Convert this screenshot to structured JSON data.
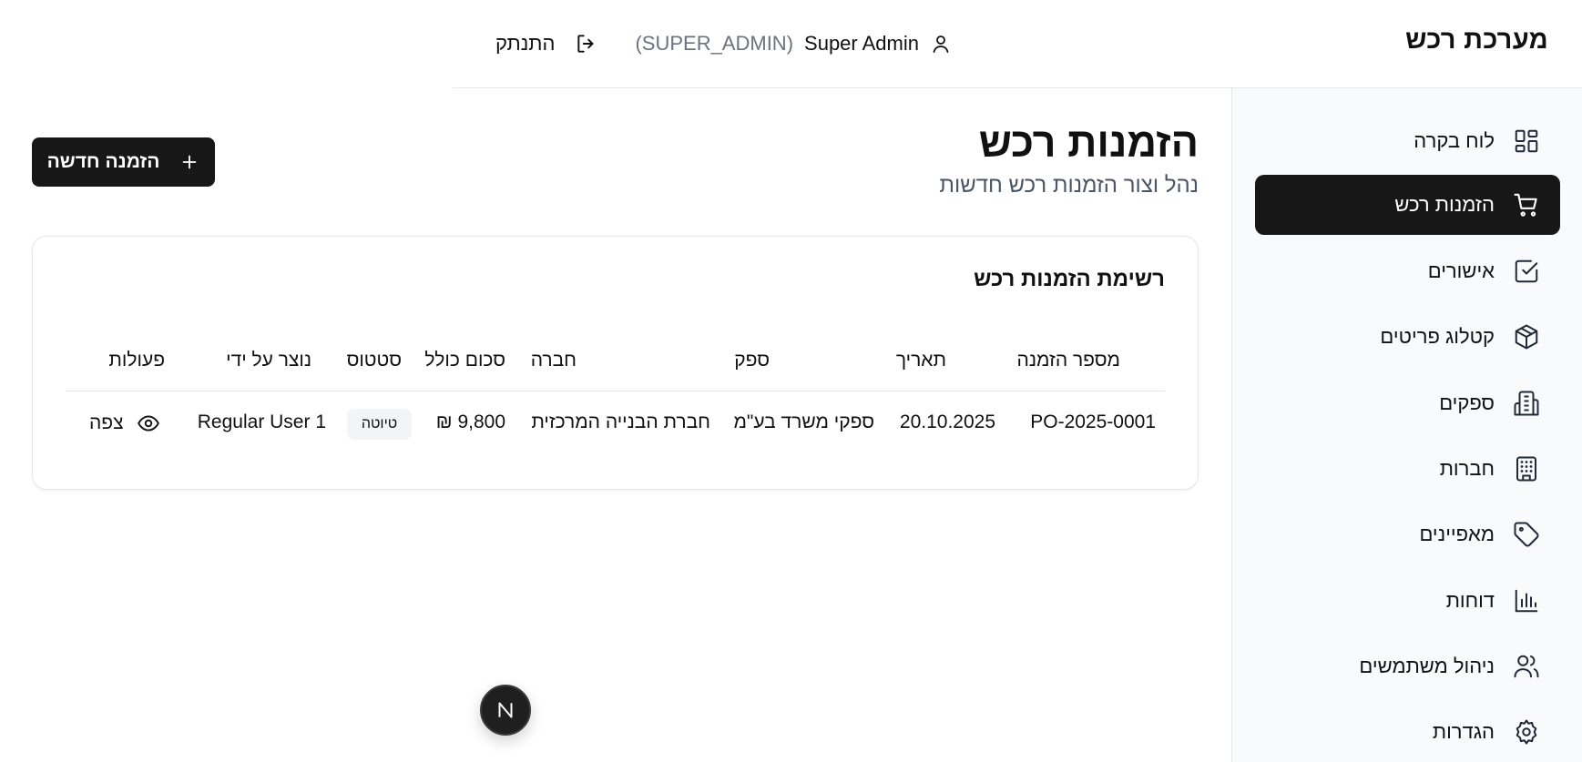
{
  "header": {
    "brand": "מערכת רכש",
    "username": "Super Admin",
    "role": "(SUPER_ADMIN)",
    "logout_label": "התנתק"
  },
  "sidebar": {
    "items": [
      {
        "label": "לוח בקרה",
        "icon": "dashboard-icon",
        "active": false
      },
      {
        "label": "הזמנות רכש",
        "icon": "cart-icon",
        "active": true
      },
      {
        "label": "אישורים",
        "icon": "check-square-icon",
        "active": false
      },
      {
        "label": "קטלוג פריטים",
        "icon": "box-icon",
        "active": false
      },
      {
        "label": "ספקים",
        "icon": "building-icon",
        "active": false
      },
      {
        "label": "חברות",
        "icon": "office-building-icon",
        "active": false
      },
      {
        "label": "מאפיינים",
        "icon": "tag-icon",
        "active": false
      },
      {
        "label": "דוחות",
        "icon": "bar-chart-icon",
        "active": false
      },
      {
        "label": "ניהול משתמשים",
        "icon": "users-icon",
        "active": false
      },
      {
        "label": "הגדרות",
        "icon": "gear-icon",
        "active": false
      }
    ]
  },
  "main": {
    "title": "הזמנות רכש",
    "subtitle": "נהל וצור הזמנות רכש חדשות",
    "new_button_label": "הזמנה חדשה",
    "card_title": "רשימת הזמנות רכש",
    "table": {
      "columns": [
        "מספר הזמנה",
        "תאריך",
        "ספק",
        "חברה",
        "סכום כולל",
        "סטטוס",
        "נוצר על ידי",
        "פעולות"
      ],
      "rows": [
        {
          "order_number": "PO-2025-0001",
          "date": "20.10.2025",
          "supplier": "ספקי משרד בע\"מ",
          "company": "חברת הבנייה המרכזית",
          "total": "₪ 9,800",
          "status": "טיוטה",
          "created_by": "Regular User 1",
          "action_label": "צפה"
        }
      ]
    }
  },
  "floating_badge": {
    "letter": "N"
  },
  "colors": {
    "accent": "#171717",
    "sidebar_bg": "#f9fafb",
    "muted_text": "#6b7280",
    "border": "#e5e7eb"
  }
}
